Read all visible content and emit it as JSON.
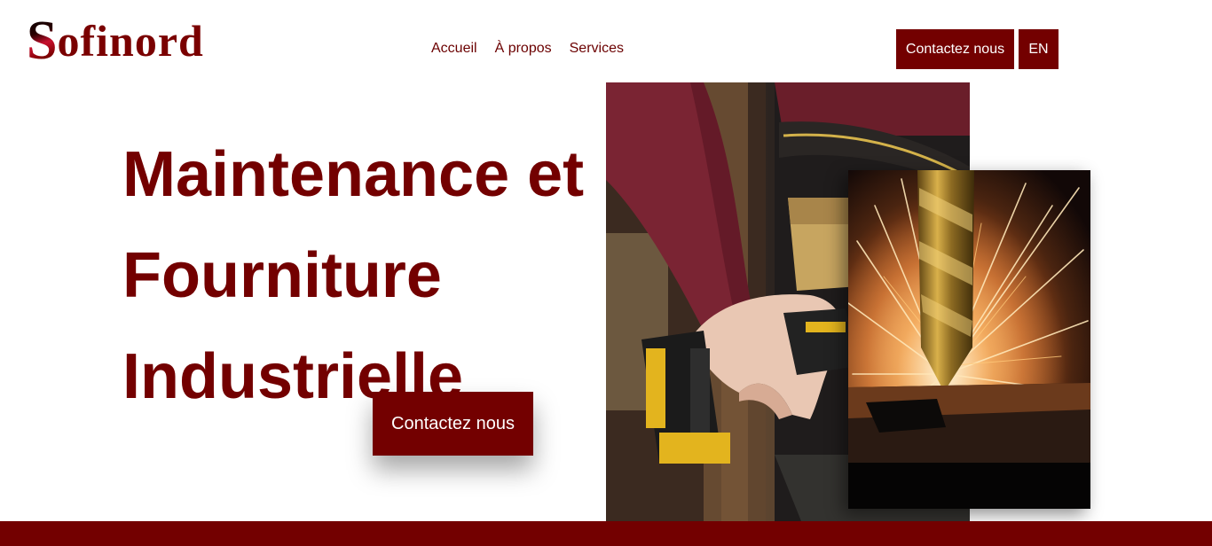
{
  "header": {
    "logo": {
      "initial": "S",
      "rest": "ofinord"
    },
    "nav": {
      "accueil": "Accueil",
      "apropos": "À propos",
      "services": "Services"
    },
    "cta_label": "Contactez nous",
    "lang_label": "EN"
  },
  "hero": {
    "title_lines": [
      "Maintenance et",
      "Fourniture",
      "Industrielle"
    ],
    "cta_label": "Contactez nous"
  },
  "colors": {
    "brand": "#730000",
    "background": "#ffffff"
  },
  "images": {
    "worker": "worker-with-power-drill-photo",
    "drill": "drill-bit-sparks-photo"
  }
}
